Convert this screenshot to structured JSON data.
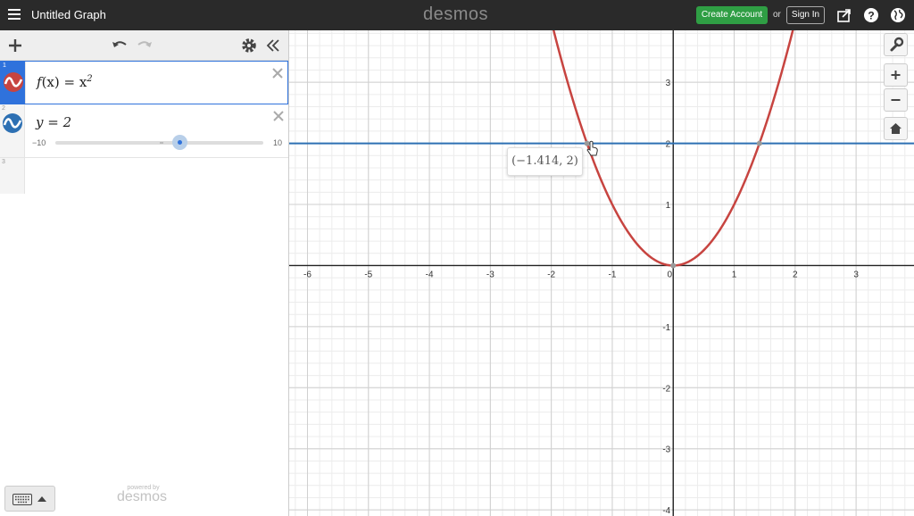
{
  "header": {
    "title": "Untitled Graph",
    "brand": "desmos",
    "create_account": "Create Account",
    "or": "or",
    "sign_in": "Sign In"
  },
  "expressions": [
    {
      "index": "1",
      "latex_parts": [
        "f",
        "(x) = x",
        "2"
      ],
      "color": "#c74440",
      "active": true
    },
    {
      "index": "2",
      "latex": "y = 2",
      "color": "#2d70b3",
      "slider": {
        "min": "−10",
        "max": "10",
        "value": 2
      }
    },
    {
      "index": "3"
    }
  ],
  "powered_by": "powered by",
  "powered_brand": "desmos",
  "graph": {
    "x_ticks": [
      "-6",
      "-5",
      "-4",
      "-3",
      "-2",
      "-1",
      "0",
      "1",
      "2",
      "3"
    ],
    "y_ticks": [
      "3",
      "2",
      "1",
      "-1",
      "-2",
      "-3",
      "-4"
    ],
    "xlim": [
      -6.3,
      3.95
    ],
    "ylim": [
      -4.1,
      3.85
    ],
    "point_label": "(−1.414, 2)",
    "intersection_points": [
      [
        -1.414,
        2
      ],
      [
        1.414,
        2
      ],
      [
        0,
        0
      ]
    ]
  },
  "chart_data": {
    "type": "line",
    "series": [
      {
        "name": "f(x) = x^2",
        "function": "x^2",
        "color": "#c74440"
      },
      {
        "name": "y = 2",
        "function": "2",
        "color": "#2d70b3"
      }
    ],
    "xlim": [
      -6.3,
      3.95
    ],
    "ylim": [
      -4.1,
      3.85
    ],
    "grid": true
  },
  "icons": {
    "menu": "menu-icon",
    "share": "share-icon",
    "help": "help-icon",
    "language": "globe-icon",
    "wrench": "wrench-icon",
    "zoom_in": "zoom-in-icon",
    "zoom_out": "zoom-out-icon",
    "home": "home-icon"
  }
}
